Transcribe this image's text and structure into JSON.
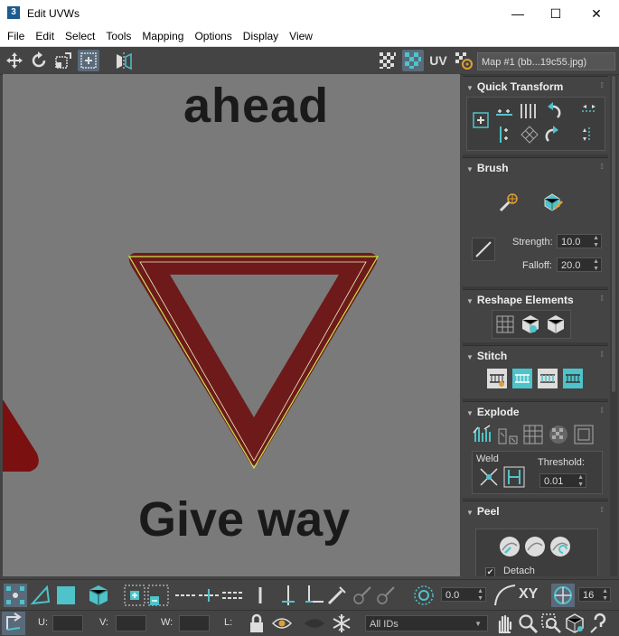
{
  "window": {
    "title": "Edit UVWs",
    "app_icon": "3"
  },
  "menu": [
    "File",
    "Edit",
    "Select",
    "Tools",
    "Mapping",
    "Options",
    "Display",
    "View"
  ],
  "toolbar": {
    "uv_label": "UV",
    "map_select": "Map #1 (bb...19c55.jpg)"
  },
  "viewport": {
    "texture_text_top": "ahead",
    "texture_text_bottom": "Give way"
  },
  "panels": {
    "quick_transform": {
      "title": "Quick Transform"
    },
    "brush": {
      "title": "Brush",
      "strength_label": "Strength:",
      "strength_value": "10.0",
      "falloff_label": "Falloff:",
      "falloff_value": "20.0"
    },
    "reshape": {
      "title": "Reshape Elements"
    },
    "stitch": {
      "title": "Stitch"
    },
    "explode": {
      "title": "Explode",
      "weld_label": "Weld",
      "threshold_label": "Threshold:",
      "threshold_value": "0.01"
    },
    "peel": {
      "title": "Peel",
      "detach_label": "Detach",
      "detach_checked": true
    }
  },
  "bottom": {
    "angle_value": "0.0",
    "xy_label": "XY",
    "grid_value": "16",
    "u_label": "U:",
    "v_label": "V:",
    "w_label": "W:",
    "l_label": "L:",
    "ids_value": "All IDs"
  },
  "colors": {
    "accent": "#4ec3c9",
    "sign_red": "#7a1010",
    "uv_edge": "#c8e84a"
  }
}
